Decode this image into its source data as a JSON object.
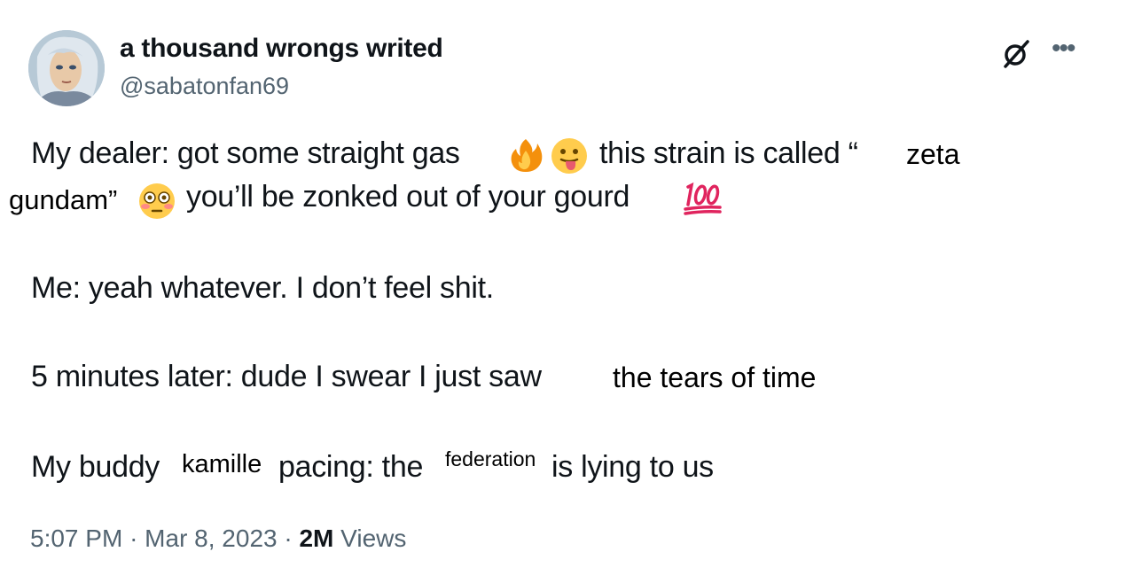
{
  "author": {
    "display_name": "a thousand wrongs writed",
    "handle": "@sabatonfan69"
  },
  "tweet": {
    "line1_a": "My dealer: got some straight gas",
    "line1_b": "this strain is called “",
    "line1_overlay": "zeta",
    "line2_overlay": "gundam”",
    "line2_a": "you’ll be zonked out of your gourd",
    "line3": "Me: yeah whatever. I don’t feel shit.",
    "line4_a": "5 minutes later: dude I swear I just saw",
    "line4_overlay": "the tears of time",
    "line5_a": "My buddy",
    "line5_overlay1": "kamille",
    "line5_b": "pacing: the",
    "line5_overlay2": "federation",
    "line5_c": "is lying to us"
  },
  "meta": {
    "time": "5:07 PM",
    "date": "Mar 8, 2023",
    "separator": "·",
    "views_count": "2M",
    "views_label": "Views"
  },
  "icons": [
    "grok-icon",
    "more-icon",
    "fire-emoji-icon",
    "tongue-emoji-icon",
    "flushed-emoji-icon",
    "hundred-emoji-icon"
  ]
}
